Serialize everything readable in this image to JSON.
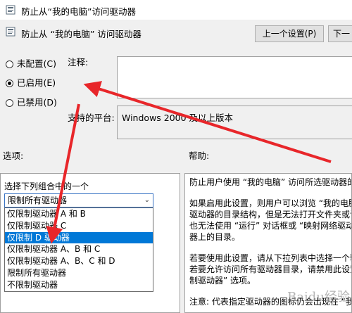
{
  "window": {
    "title": "防止从“我的电脑”访问驱动器"
  },
  "header": {
    "policy_title": "防止从 “我的电脑” 访问驱动器",
    "prev_button": "上一个设置(P)",
    "next_button": "下一"
  },
  "state": {
    "radios": [
      {
        "label": "未配置(C)",
        "checked": false
      },
      {
        "label": "已启用(E)",
        "checked": true
      },
      {
        "label": "已禁用(D)",
        "checked": false
      }
    ]
  },
  "comment": {
    "label": "注释:",
    "value": ""
  },
  "platform": {
    "label": "支持的平台:",
    "value": "Windows 2000 及以上版本"
  },
  "options": {
    "label": "选项:",
    "combo_label": "选择下列组合中的一个",
    "combo_value": "限制所有驱动器",
    "dropdown_items": [
      "仅限制驱动器 A 和 B",
      "仅限制驱动器 C",
      "仅限制 D 驱动器",
      "仅限制驱动器 A、B 和 C",
      "仅限制驱动器 A、B、C 和 D",
      "限制所有驱动器",
      "不限制驱动器"
    ],
    "selected_index": 2
  },
  "help": {
    "label": "帮助:",
    "p1": "防止用户使用 “我的电脑” 访问所选驱动器的",
    "p2_lines": [
      "如果启用此设置，则用户可以浏览 “我的电脑",
      "驱动器的目录结构，但是无法打开文件夹或访",
      "也无法使用 “运行” 对话框或 “映射网络驱动",
      "器上的目录。"
    ],
    "p3_lines": [
      "若要使用此设置，请从下拉列表中选择一个驱",
      "若要允许访问所有驱动器目录，请禁用此设置",
      "制驱动器” 选项。"
    ],
    "p4": "注意: 代表指定驱动器的图标仍会出现在 “我"
  },
  "watermark": "Baidu经验",
  "colors": {
    "selection": "#0078d7",
    "arrow": "#e8262a",
    "panel": "#f0f0f0"
  }
}
